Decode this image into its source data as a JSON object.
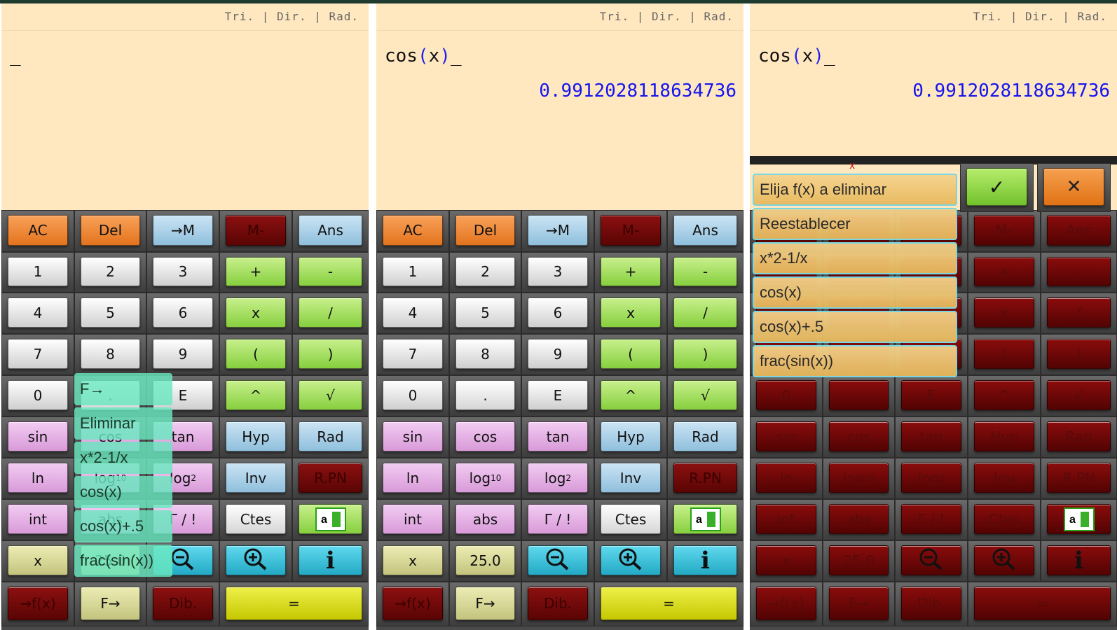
{
  "display": {
    "modes": "Tri. | Dir. | Rad.",
    "cursor": "_",
    "expr_func": "cos",
    "expr_open": "(",
    "expr_var": "x",
    "expr_close": ")",
    "result": "0.9912028118634736"
  },
  "keypad": {
    "rows": [
      [
        "AC",
        "Del",
        "→M",
        "M-",
        "Ans"
      ],
      [
        "1",
        "2",
        "3",
        "+",
        "-"
      ],
      [
        "4",
        "5",
        "6",
        "x",
        "/"
      ],
      [
        "7",
        "8",
        "9",
        "(",
        ")"
      ],
      [
        "0",
        ".",
        "E",
        "^",
        "√"
      ],
      [
        "sin",
        "cos",
        "tan",
        "Hyp",
        "Rad"
      ],
      [
        "ln",
        "log10",
        "log2",
        "Inv",
        "R.PN"
      ],
      [
        "int",
        "abs",
        "Γ / !",
        "Ctes",
        "chart"
      ],
      [
        "x",
        "25.0",
        "zoom-out",
        "zoom-in",
        "i"
      ],
      [
        "→f(x)",
        "F→",
        "Dib.",
        "=",
        ""
      ]
    ],
    "log10_base": "log",
    "log10_sub": "10",
    "log2_base": "log",
    "log2_sub": "2",
    "info_label": "i",
    "colors": {
      "display_bg": "#ffe8c0",
      "result_text": "#1515ee",
      "equals": "#e0e01a"
    }
  },
  "menu_panel1": {
    "items": [
      "F→",
      "Eliminar",
      "x*2-1/x",
      "cos(x)",
      "cos(x)+.5",
      "frac(sin(x))"
    ]
  },
  "menu_panel3": {
    "title": "Elija f(x) a eliminar",
    "items": [
      "Reestablecer",
      "x*2-1/x",
      "cos(x)",
      "cos(x)+.5",
      "frac(sin(x))"
    ],
    "ok_label": "✓",
    "cancel_label": "✕",
    "close_mark": "x"
  }
}
